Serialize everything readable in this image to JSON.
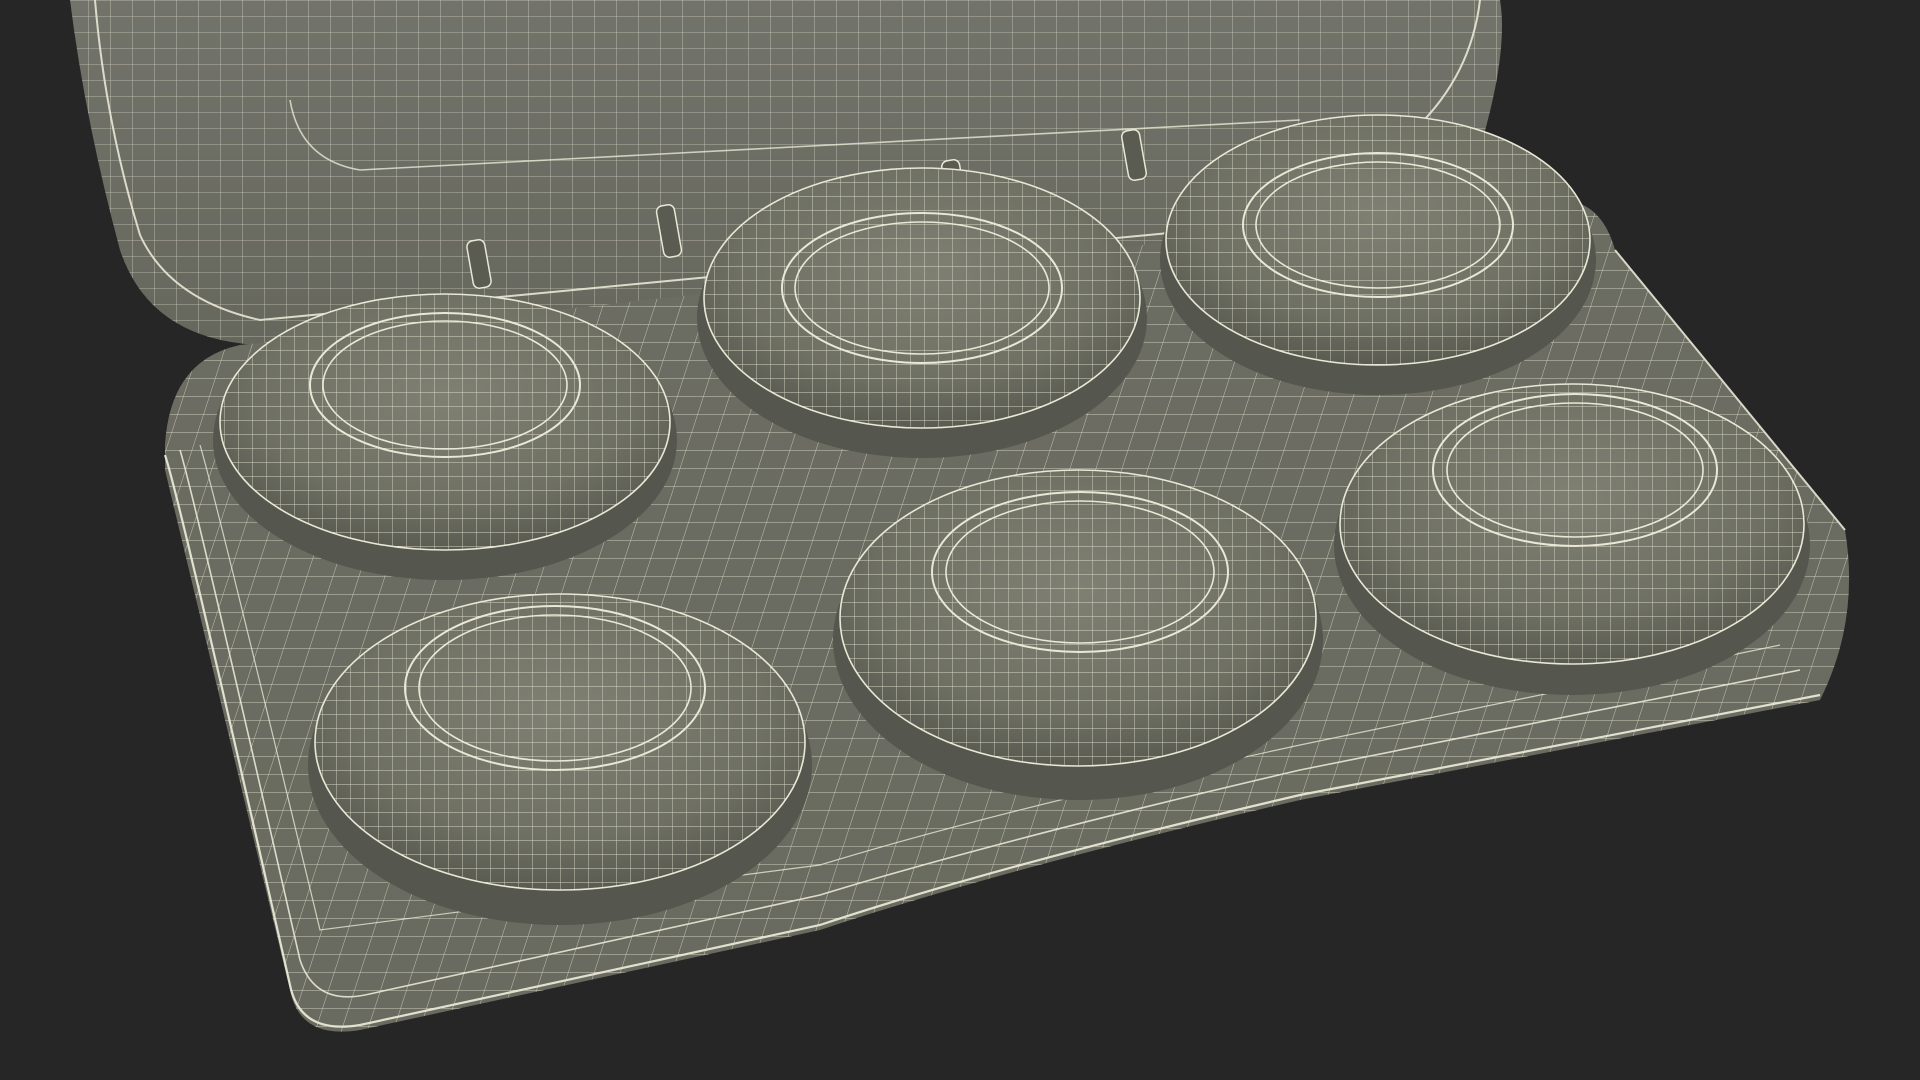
{
  "scene": {
    "background_color": "#262626",
    "mesh_fill": "#6f7064",
    "mesh_fill_light": "#7f8073",
    "mesh_fill_dark": "#5a5b51",
    "wire_color": "#e9e8d6",
    "object_count": 6
  },
  "objects": [
    {
      "name": "macaron-top-left"
    },
    {
      "name": "macaron-top-center"
    },
    {
      "name": "macaron-top-right"
    },
    {
      "name": "macaron-bottom-left"
    },
    {
      "name": "macaron-bottom-center"
    },
    {
      "name": "macaron-bottom-right"
    }
  ]
}
